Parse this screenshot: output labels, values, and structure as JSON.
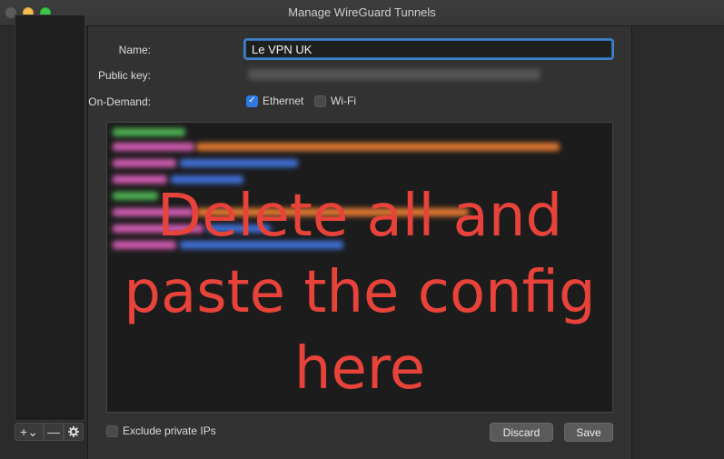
{
  "window": {
    "title": "Manage WireGuard Tunnels"
  },
  "sidebar": {
    "add_label": "+⌄",
    "remove_label": "—",
    "gear_icon": "gear-icon"
  },
  "form": {
    "name_label": "Name:",
    "name_value": "Le VPN UK",
    "pubkey_label": "Public key:",
    "ondemand_label": "On-Demand:",
    "ethernet": {
      "label": "Ethernet",
      "checked": true
    },
    "wifi": {
      "label": "Wi-Fi",
      "checked": false
    }
  },
  "config": {
    "overlay_lines": [
      "Delete all and",
      "paste the config",
      "here"
    ]
  },
  "footer": {
    "exclude_label": "Exclude private IPs",
    "discard_label": "Discard",
    "save_label": "Save"
  },
  "colors": {
    "accent": "#2d7ae0",
    "overlay": "#e8433a"
  }
}
